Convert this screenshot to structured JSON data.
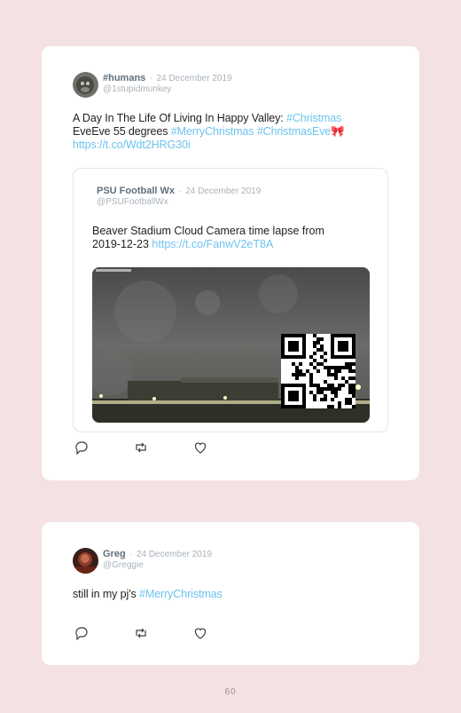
{
  "tweets": [
    {
      "name": "#humans",
      "date": "24 December 2019",
      "handle": "@1stupidmunkey",
      "text": {
        "p1": "A Day In The Life Of Living In Happy Valley: ",
        "tag1": "#Christmas",
        "p2": "EveEve 55 degrees ",
        "tag2": "#MerryChristmas",
        "tag3": "#ChristmasEve",
        "emoji": "🎀",
        "link": "https://t.co/Wdt2HRG30i"
      },
      "quoted": {
        "name": "PSU Football Wx",
        "date": "24 December 2019",
        "handle": "@PSUFootballWx",
        "text_l1": "Beaver Stadium Cloud Camera time lapse from",
        "text_l2": "2019-12-23 ",
        "link": "https://t.co/FanwV2eT8A"
      }
    },
    {
      "name": "Greg",
      "date": "24 December 2019",
      "handle": "@Greggie",
      "text": {
        "p1": "still in my pj's ",
        "tag1": "#MerryChristmas"
      }
    }
  ],
  "separator": "·",
  "page_number": "60",
  "icons": [
    "reply-icon",
    "retweet-icon",
    "like-icon"
  ],
  "colors": {
    "hashtag": "#6cc3ef",
    "background": "#f4e1e3",
    "name": "#5f6f7d"
  }
}
